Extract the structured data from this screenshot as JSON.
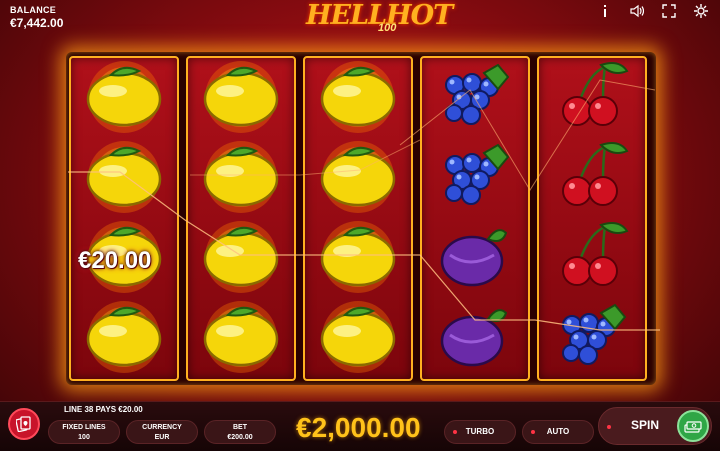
{
  "header": {
    "balance_label": "BALANCE",
    "balance_value": "€7,442.00",
    "logo_title": "HELLHOT",
    "logo_subtitle": "100",
    "icons": [
      "info-icon",
      "sound-icon",
      "fullscreen-icon",
      "settings-icon"
    ]
  },
  "reels": [
    [
      "lemon",
      "lemon",
      "lemon",
      "lemon"
    ],
    [
      "lemon",
      "lemon",
      "lemon",
      "lemon"
    ],
    [
      "lemon",
      "lemon",
      "lemon",
      "lemon"
    ],
    [
      "grapes",
      "grapes",
      "plum",
      "plum"
    ],
    [
      "cherry",
      "cherry",
      "cherry",
      "grapes"
    ]
  ],
  "win_overlay": "€20.00",
  "footer": {
    "line_pays": "LINE 38 PAYS €20.00",
    "fixed_lines_label": "FIXED LINES",
    "fixed_lines_value": "100",
    "currency_label": "CURRENCY",
    "currency_value": "EUR",
    "bet_label": "BET",
    "bet_value": "€200.00",
    "total_win": "€2,000.00",
    "turbo_label": "TURBO",
    "auto_label": "AUTO",
    "spin_label": "SPIN"
  },
  "colors": {
    "accent": "#ffc21a",
    "frame_glow": "#ffb020",
    "background": "#7a0a0e",
    "spin_green": "#2fa646"
  }
}
